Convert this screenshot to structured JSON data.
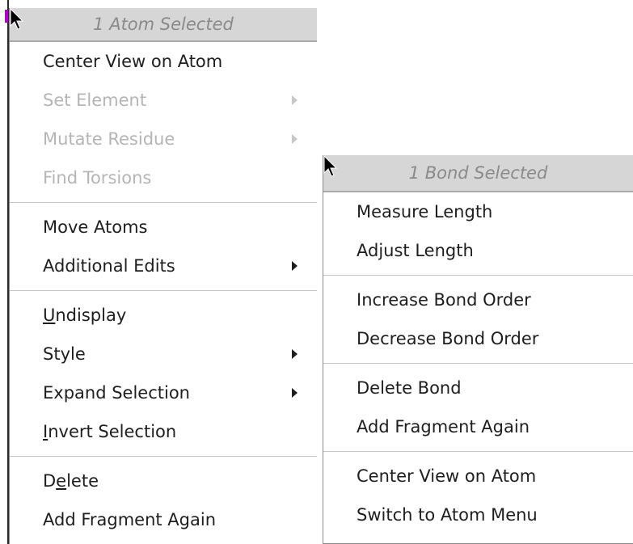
{
  "atom_menu": {
    "header": "1 Atom Selected",
    "groups": [
      [
        {
          "label": "Center View on Atom",
          "enabled": true,
          "submenu": false
        },
        {
          "label": "Set Element",
          "enabled": false,
          "submenu": true
        },
        {
          "label": "Mutate Residue",
          "enabled": false,
          "submenu": true
        },
        {
          "label": "Find Torsions",
          "enabled": false,
          "submenu": false
        }
      ],
      [
        {
          "label": "Move Atoms",
          "enabled": true,
          "submenu": false
        },
        {
          "label": "Additional Edits",
          "enabled": true,
          "submenu": true
        }
      ],
      [
        {
          "label_pre": "",
          "label_u": "U",
          "label_post": "ndisplay",
          "enabled": true,
          "submenu": false
        },
        {
          "label": "Style",
          "enabled": true,
          "submenu": true
        },
        {
          "label": "Expand Selection",
          "enabled": true,
          "submenu": true
        },
        {
          "label_pre": "",
          "label_u": "I",
          "label_post": "nvert Selection",
          "enabled": true,
          "submenu": false
        }
      ],
      [
        {
          "label_pre": "D",
          "label_u": "e",
          "label_post": "lete",
          "enabled": true,
          "submenu": false
        },
        {
          "label": "Add Fragment Again",
          "enabled": true,
          "submenu": false
        }
      ]
    ]
  },
  "bond_menu": {
    "header": "1 Bond Selected",
    "groups": [
      [
        {
          "label": "Measure Length"
        },
        {
          "label": "Adjust Length"
        }
      ],
      [
        {
          "label": "Increase Bond Order"
        },
        {
          "label": "Decrease Bond Order"
        }
      ],
      [
        {
          "label": "Delete Bond"
        },
        {
          "label": "Add Fragment Again"
        }
      ],
      [
        {
          "label": "Center View on Atom"
        },
        {
          "label": "Switch to Atom Menu"
        }
      ]
    ]
  },
  "colors": {
    "header_bg": "#d6d6d6",
    "header_text": "#8a8a8a",
    "text": "#1e1e1e",
    "disabled_text": "#b5b5b5"
  },
  "icons": [
    "mouse-pointer-icon",
    "submenu-arrow-icon"
  ]
}
